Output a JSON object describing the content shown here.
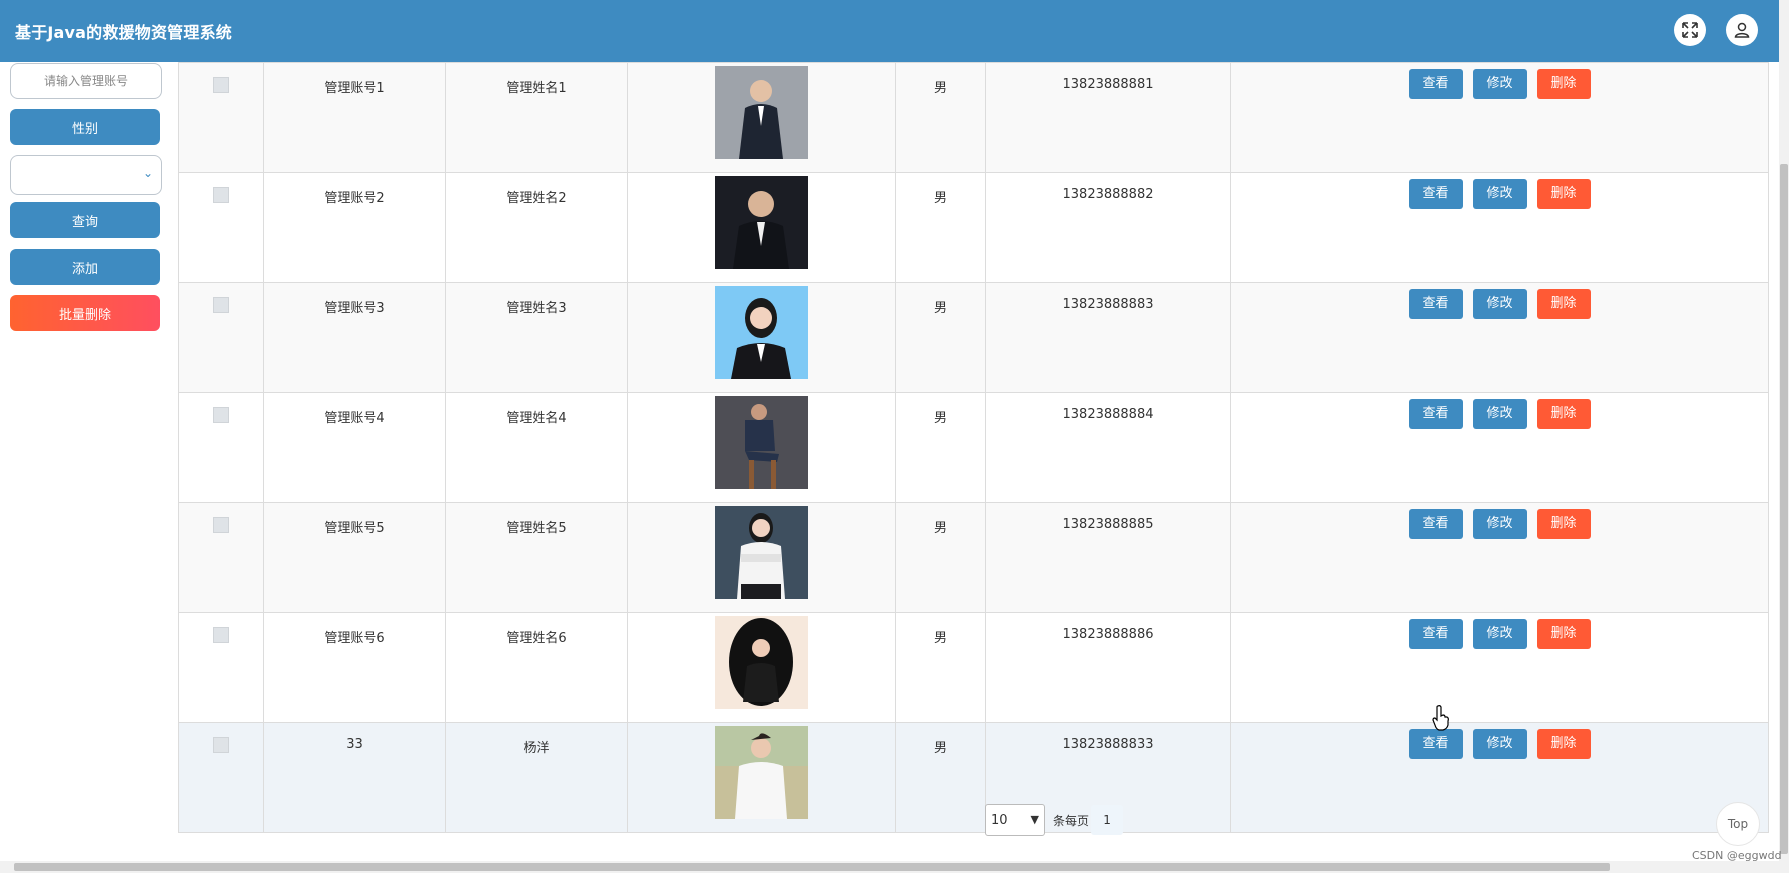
{
  "header": {
    "title": "基于Java的救援物资管理系统"
  },
  "sidebar": {
    "search_placeholder": "请输入管理账号",
    "gender_label": "性别",
    "query_label": "查询",
    "add_label": "添加",
    "batch_delete_label": "批量删除"
  },
  "actions": {
    "view": "查看",
    "edit": "修改",
    "delete": "删除"
  },
  "rows": [
    {
      "account": "管理账号1",
      "name": "管理姓名1",
      "gender": "男",
      "phone": "13823888881"
    },
    {
      "account": "管理账号2",
      "name": "管理姓名2",
      "gender": "男",
      "phone": "13823888882"
    },
    {
      "account": "管理账号3",
      "name": "管理姓名3",
      "gender": "男",
      "phone": "13823888883"
    },
    {
      "account": "管理账号4",
      "name": "管理姓名4",
      "gender": "男",
      "phone": "13823888884"
    },
    {
      "account": "管理账号5",
      "name": "管理姓名5",
      "gender": "男",
      "phone": "13823888885"
    },
    {
      "account": "管理账号6",
      "name": "管理姓名6",
      "gender": "男",
      "phone": "13823888886"
    },
    {
      "account": "33",
      "name": "杨洋",
      "gender": "男",
      "phone": "13823888833"
    }
  ],
  "pagination": {
    "page_size": "10",
    "per_page_label": "条每页",
    "current_page": "1"
  },
  "top_label": "Top",
  "watermark": "CSDN @eggwdd",
  "colors": {
    "primary": "#3e8bc1",
    "danger": "#ff5a35"
  }
}
